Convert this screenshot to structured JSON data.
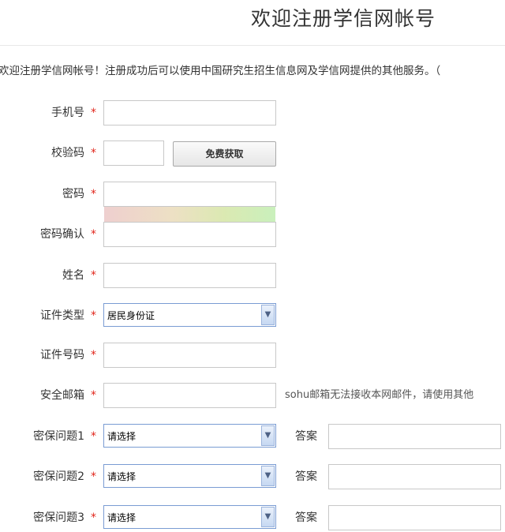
{
  "page": {
    "title": "欢迎注册学信网帐号",
    "intro": "欢迎注册学信网帐号！注册成功后可以使用中国研究生招生信息网及学信网提供的其他服务。（"
  },
  "form": {
    "required_mark": "*",
    "phone": {
      "label": "手机号",
      "value": ""
    },
    "code": {
      "label": "校验码",
      "value": "",
      "button": "免费获取"
    },
    "password": {
      "label": "密码",
      "value": ""
    },
    "password_confirm": {
      "label": "密码确认",
      "value": ""
    },
    "name": {
      "label": "姓名",
      "value": ""
    },
    "id_type": {
      "label": "证件类型",
      "selected": "居民身份证"
    },
    "id_number": {
      "label": "证件号码",
      "value": ""
    },
    "email": {
      "label": "安全邮箱",
      "value": "",
      "hint": "sohu邮箱无法接收本网邮件，请使用其他"
    },
    "security_questions": [
      {
        "label": "密保问题1",
        "selected": "请选择",
        "answer_label": "答案",
        "answer": ""
      },
      {
        "label": "密保问题2",
        "selected": "请选择",
        "answer_label": "答案",
        "answer": ""
      },
      {
        "label": "密保问题3",
        "selected": "请选择",
        "answer_label": "答案",
        "answer": ""
      }
    ]
  },
  "icons": {
    "select_arrow": "chevron-down-icon"
  },
  "colors": {
    "required": "#e1251b",
    "select_border": "#7a9cd3"
  }
}
